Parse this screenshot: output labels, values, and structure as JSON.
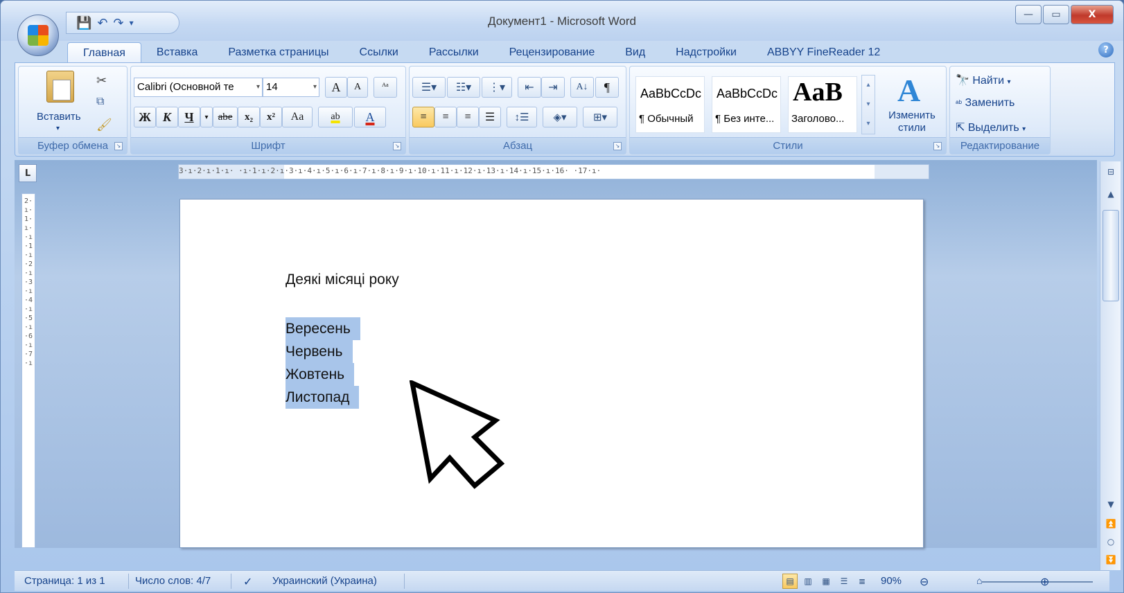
{
  "window": {
    "title": "Документ1 - Microsoft Word",
    "office_button_label": "Office",
    "qat_icons": [
      "save-icon",
      "undo-icon",
      "redo-icon",
      "customize-icon"
    ],
    "controls": {
      "minimize": "—",
      "maximize": "▭",
      "close": "X"
    }
  },
  "tabs": [
    "Главная",
    "Вставка",
    "Разметка страницы",
    "Ссылки",
    "Рассылки",
    "Рецензирование",
    "Вид",
    "Надстройки",
    "ABBYY FineReader 12"
  ],
  "ribbon": {
    "clipboard": {
      "paste_label": "Вставить",
      "group_label": "Буфер обмена"
    },
    "font": {
      "font_name": "Calibri (Основной те",
      "font_size": "14",
      "group_label": "Шрифт",
      "bold": "Ж",
      "italic": "К",
      "underline": "Ч",
      "strike": "abe",
      "sub": "x₂",
      "sup": "x²",
      "case": "Aa",
      "highlight": "ab",
      "color": "A",
      "grow": "A",
      "shrink": "A"
    },
    "paragraph": {
      "group_label": "Абзац",
      "pilcrow": "¶"
    },
    "styles": {
      "group_label": "Стили",
      "items": [
        {
          "sample": "AaBbCcDc",
          "name": "¶ Обычный"
        },
        {
          "sample": "AaBbCcDc",
          "name": "¶ Без инте..."
        },
        {
          "sample": "AaB",
          "name": "Заголово..."
        }
      ],
      "change_label": "Изменить стили"
    },
    "editing": {
      "find": "Найти",
      "replace": "Заменить",
      "select": "Выделить",
      "group_label": "Редактирование"
    }
  },
  "ruler": {
    "horizontal": "3·ı·2·ı·1·ı·  ·ı·1·ı·2·ı·3·ı·4·ı·5·ı·6·ı·7·ı·8·ı·9·ı·10·ı·11·ı·12·ı·13·ı·14·ı·15·ı·16· ·17·ı·",
    "vertical": "2·ı·1·ı··ı·1·ı·2·ı·3·ı·4·ı·5·ı·6·ı·7·ı"
  },
  "document": {
    "heading": "Деякі місяці року",
    "items": [
      "Вересень",
      "Червень",
      "Жовтень",
      "Листопад"
    ]
  },
  "status": {
    "page": "Страница: 1 из 1",
    "words": "Число слов: 4/7",
    "language": "Украинский (Украина)",
    "zoom": "90%"
  }
}
